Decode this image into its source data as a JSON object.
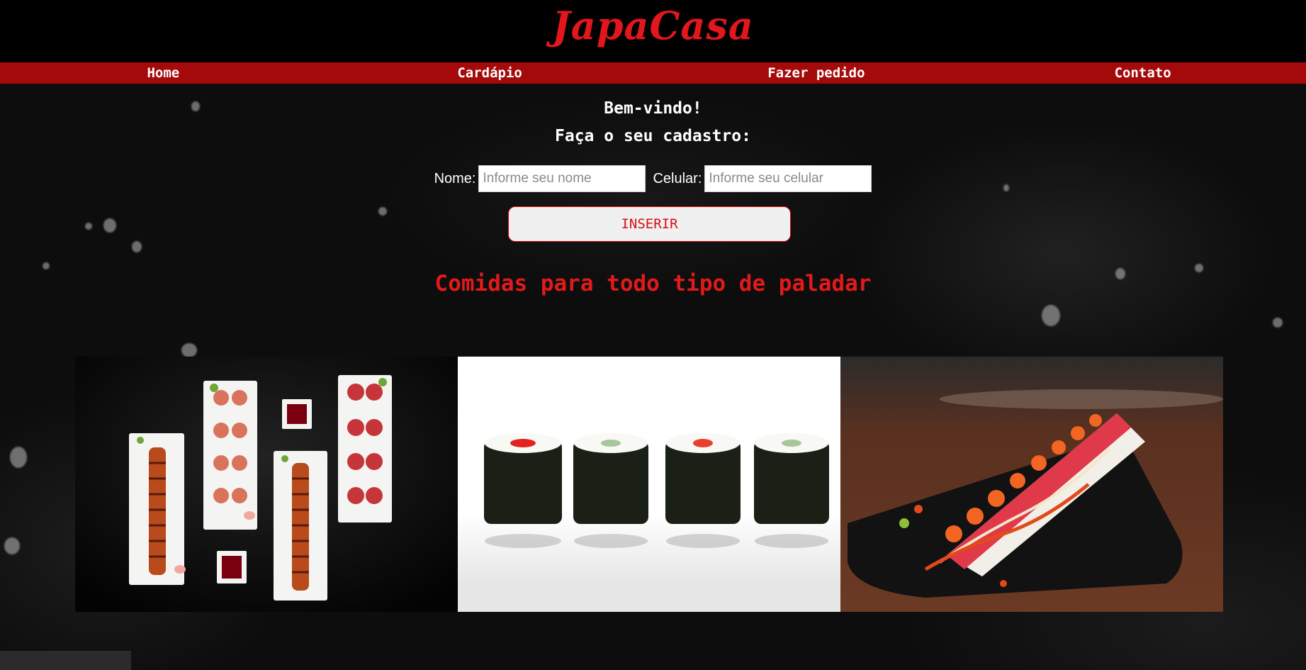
{
  "header": {
    "logo": "JapaCasa"
  },
  "nav": {
    "items": [
      "Home",
      "Cardápio",
      "Fazer pedido",
      "Contato"
    ]
  },
  "welcome": {
    "line1": "Bem-vindo!",
    "line2": "Faça o seu cadastro:"
  },
  "form": {
    "name_label": "Nome:",
    "name_placeholder": "Informe seu nome",
    "phone_label": "Celular:",
    "phone_placeholder": "Informe seu celular",
    "submit_label": "INSERIR"
  },
  "tagline": "Comidas para todo tipo de paladar",
  "colors": {
    "accent": "#a40a0a",
    "logo": "#e4161d",
    "tagline": "#e21a1a",
    "background": "#0b0b0b"
  },
  "gallery": {
    "images": [
      "sushi-platter-image",
      "maki-rolls-image",
      "salmon-roe-roll-image"
    ]
  }
}
